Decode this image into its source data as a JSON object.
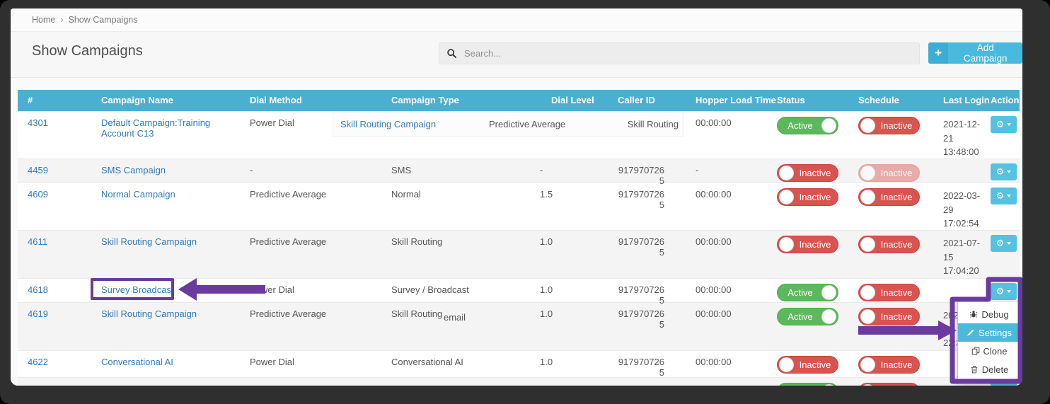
{
  "breadcrumb": {
    "home": "Home",
    "separator": "›",
    "current": "Show Campaigns"
  },
  "header": {
    "title": "Show Campaigns",
    "search_placeholder": "Search...",
    "add_campaign_plus": "+",
    "add_campaign_label": "Add Campaign"
  },
  "table": {
    "columns": [
      "#",
      "Campaign Name",
      "Dial Method",
      "Campaign Type",
      "Dial Level",
      "Caller ID",
      "Hopper Load Time",
      "Status",
      "Schedule",
      "Last Login",
      "Action"
    ],
    "rows": [
      {
        "id": "4301",
        "campaign_name": "Default Campaign:Training Account C13",
        "dial_method": "Power Dial",
        "campaign_type": "",
        "dial_level": "",
        "caller_id": "",
        "hopper_load_time": "00:00:00",
        "status": "Active",
        "schedule": "Inactive",
        "last_login": "2021-12-21 13:48:00"
      },
      {
        "id": "4459",
        "campaign_name": "SMS Campaign",
        "dial_method": "-",
        "campaign_type": "SMS",
        "dial_level": "-",
        "caller_id": "9179707265",
        "hopper_load_time": "-",
        "status": "Inactive",
        "schedule": "Inactive",
        "last_login": ""
      },
      {
        "id": "4609",
        "campaign_name": "Normal Campaign",
        "dial_method": "Predictive Average",
        "campaign_type": "Normal",
        "dial_level": "1.5",
        "caller_id": "9179707265",
        "hopper_load_time": "00:00:00",
        "status": "Inactive",
        "schedule": "Inactive",
        "last_login": "2022-03-29 17:02:54"
      },
      {
        "id": "4611",
        "campaign_name": "Skill Routing Campaign",
        "dial_method": "Predictive Average",
        "campaign_type": "Skill Routing",
        "dial_level": "1.0",
        "caller_id": "9179707265",
        "hopper_load_time": "00:00:00",
        "status": "Inactive",
        "schedule": "Inactive",
        "last_login": "2021-07-15 17:04:20"
      },
      {
        "id": "4618",
        "campaign_name": "Survey Broadcast",
        "dial_method": "Power Dial",
        "campaign_type": "Survey / Broadcast",
        "dial_level": "1.0",
        "caller_id": "9179707265",
        "hopper_load_time": "00:00:00",
        "status": "Active",
        "schedule": "Inactive",
        "last_login": ""
      },
      {
        "id": "4619",
        "campaign_name": "Skill Routing Campaign",
        "dial_method": "Predictive Average",
        "campaign_type": "Skill Routing",
        "dial_level": "1.0",
        "caller_id": "9179707265",
        "hopper_load_time": "00:00:00",
        "status": "Active",
        "schedule": "Inactive",
        "last_login_lines": [
          "202",
          "19",
          "22:3"
        ]
      },
      {
        "id": "4622",
        "campaign_name": "Conversational AI",
        "dial_method": "Power Dial",
        "campaign_type": "Conversational AI",
        "dial_level": "1.0",
        "caller_id": "9179707265",
        "hopper_load_time": "00:00:00",
        "status": "Inactive",
        "schedule": "Inactive",
        "last_login": ""
      },
      {
        "id": "",
        "status": "Active",
        "schedule": "Inactive"
      }
    ]
  },
  "ghost_row": {
    "campaign_name": "Skill Routing Campaign",
    "dial_method": "Predictive Average",
    "campaign_type": "Skill Routing"
  },
  "stray_text": "email",
  "action_menu": {
    "items": [
      {
        "label": "Debug",
        "icon": "bug-icon"
      },
      {
        "label": "Settings",
        "icon": "pencil-icon",
        "active": true
      },
      {
        "label": "Clone",
        "icon": "clone-icon"
      },
      {
        "label": "Delete",
        "icon": "trash-icon"
      }
    ]
  },
  "colors": {
    "table_header_blue": "#4bafd1",
    "add_button_blue": "#49b9de",
    "gear_button_blue": "#54c2e0",
    "active_green": "#5cb85c",
    "inactive_red": "#d9534f",
    "link_blue": "#337ab7",
    "annotation_purple": "#6a3a9e",
    "menu_active_blue": "#4db9d9"
  }
}
